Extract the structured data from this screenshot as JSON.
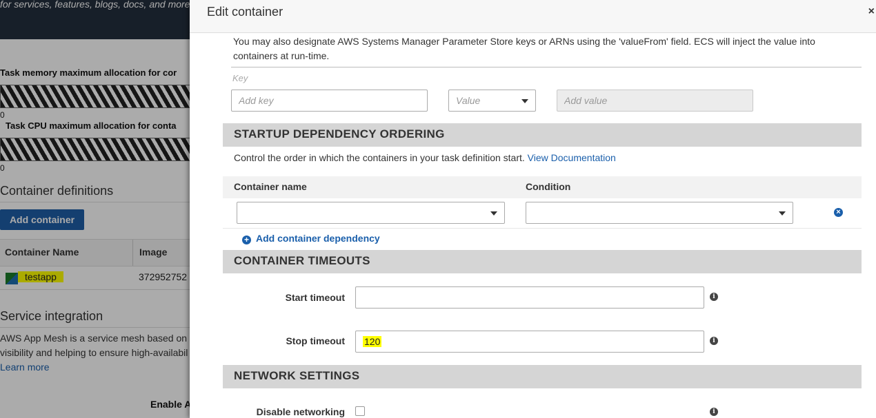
{
  "background": {
    "search_hint": "for services, features, blogs, docs, and more",
    "memory_label": "Task memory maximum allocation for cor",
    "cpu_label": "Task CPU maximum allocation for conta",
    "zero": "0",
    "container_definitions_heading": "Container definitions",
    "add_container_button": "Add container",
    "table_headers": [
      "Container Name",
      "Image"
    ],
    "row": {
      "name": "testapp",
      "image": "372952752"
    },
    "service_integration_heading": "Service integration",
    "app_mesh_text_1": "AWS App Mesh is a service mesh based on",
    "app_mesh_text_2": "visibility and helping to ensure high-availabil",
    "learn_more": "Learn more",
    "enable_label": "Enable A"
  },
  "modal": {
    "title": "Edit container",
    "close": "×",
    "help_text": "You may also designate AWS Systems Manager Parameter Store keys or ARNs using the 'valueFrom' field. ECS will inject the value into containers at run-time.",
    "key_label": "Key",
    "key_placeholder": "Add key",
    "value_select": "Value",
    "value_placeholder": "Add value",
    "startup": {
      "title": "STARTUP DEPENDENCY ORDERING",
      "description": "Control the order in which the containers in your task definition start.",
      "doc_link": "View Documentation",
      "col_container_name": "Container name",
      "col_condition": "Condition",
      "add_dependency": "Add container dependency"
    },
    "timeouts": {
      "title": "CONTAINER TIMEOUTS",
      "start_label": "Start timeout",
      "start_value": "",
      "stop_label": "Stop timeout",
      "stop_value": "120"
    },
    "network": {
      "title": "NETWORK SETTINGS",
      "disable_label": "Disable networking",
      "disable_checked": false
    }
  },
  "colors": {
    "header_dark": "#232f3e",
    "link_blue": "#1a5fab",
    "section_gray": "#d5d5d5",
    "highlight": "#ffff00"
  }
}
